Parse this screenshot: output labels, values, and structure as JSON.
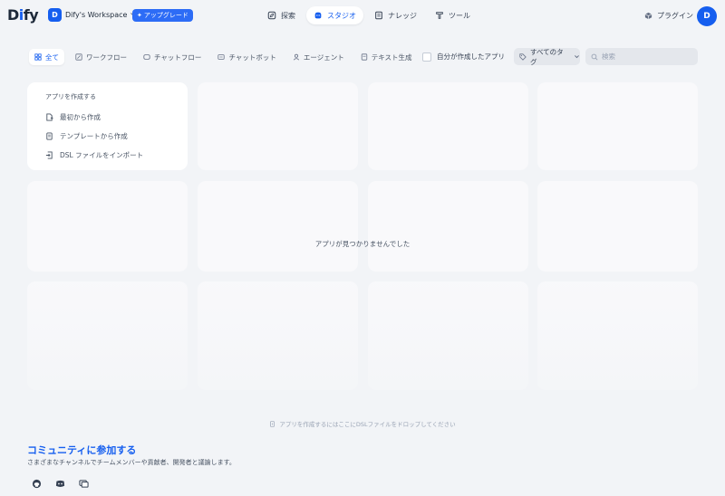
{
  "header": {
    "logo": {
      "prefix": "D",
      "accent": "i",
      "suffix": "fy"
    },
    "workspace": {
      "initial": "D",
      "name": "Dify's Workspace"
    },
    "upgrade_label": "アップグレード",
    "nav": [
      {
        "label": "探索",
        "icon": "explore-icon",
        "active": false
      },
      {
        "label": "スタジオ",
        "icon": "studio-icon",
        "active": true
      },
      {
        "label": "ナレッジ",
        "icon": "knowledge-icon",
        "active": false
      },
      {
        "label": "ツール",
        "icon": "tool-icon",
        "active": false
      }
    ],
    "plugin_label": "プラグイン",
    "user_initial": "D"
  },
  "filters": {
    "tabs": [
      {
        "label": "全て",
        "icon": "grid-icon",
        "active": true
      },
      {
        "label": "ワークフロー",
        "icon": "workflow-icon",
        "active": false
      },
      {
        "label": "チャットフロー",
        "icon": "chatflow-icon",
        "active": false
      },
      {
        "label": "チャットボット",
        "icon": "chatbot-icon",
        "active": false
      },
      {
        "label": "エージェント",
        "icon": "agent-icon",
        "active": false
      },
      {
        "label": "テキスト生成",
        "icon": "text-generation-icon",
        "active": false
      }
    ],
    "created_by_me_label": "自分が作成したアプリ",
    "tags_label": "すべてのタグ",
    "search_placeholder": "検索"
  },
  "create_card": {
    "title": "アプリを作成する",
    "items": [
      {
        "label": "最初から作成",
        "icon": "new-file-icon"
      },
      {
        "label": "テンプレートから作成",
        "icon": "template-icon"
      },
      {
        "label": "DSL ファイルをインポート",
        "icon": "import-icon"
      }
    ]
  },
  "empty_message": "アプリが見つかりませんでした",
  "drop_hint": "アプリを作成するにはここにDSLファイルをドロップしてください",
  "community": {
    "title": "コミュニティに参加する",
    "description": "さまざまなチャンネルでチームメンバーや貢献者、開発者と議論します。",
    "links": [
      "github-icon",
      "discord-icon",
      "forum-icon"
    ]
  },
  "colors": {
    "accent": "#155eef",
    "background": "#f2f4f7",
    "card": "#ffffff"
  }
}
